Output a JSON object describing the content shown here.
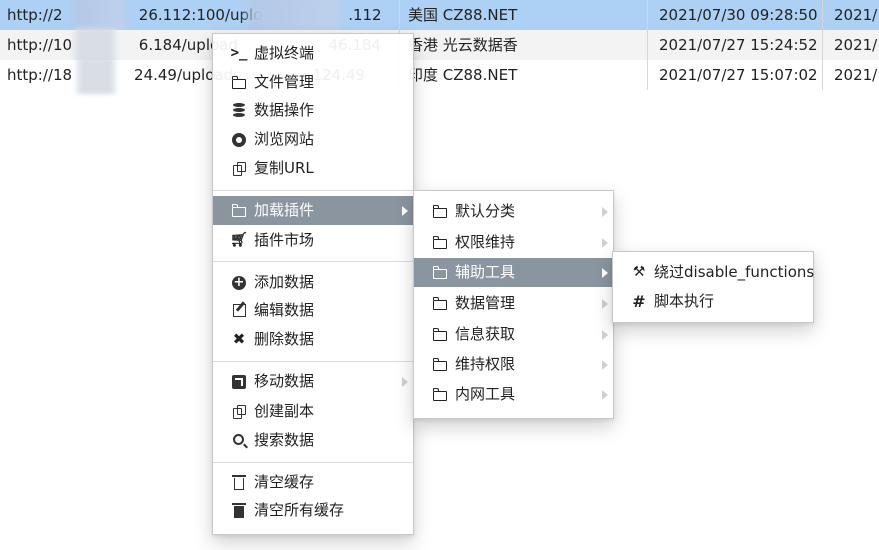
{
  "table": {
    "rows": [
      {
        "url": "http://2                26.112:100/uplo                  .112",
        "location": "美国 CZ88.NET",
        "time1": "2021/07/30 09:28:50",
        "time2": "2021/"
      },
      {
        "url": "http://10              6.184/upload                   46.184",
        "location": "香港 光云数据香",
        "time1": "2021/07/27 15:24:52",
        "time2": "2021/"
      },
      {
        "url": "http://18             24.49/uploads               124.49",
        "location": "印度 CZ88.NET",
        "time1": "2021/07/27 15:07:02",
        "time2": "2021/"
      }
    ]
  },
  "context_menu": {
    "items": [
      {
        "label": "虚拟终端",
        "icon": "terminal-icon"
      },
      {
        "label": "文件管理",
        "icon": "folder-icon"
      },
      {
        "label": "数据操作",
        "icon": "database-icon"
      },
      {
        "label": "浏览网站",
        "icon": "chrome-icon"
      },
      {
        "label": "复制URL",
        "icon": "copy-icon"
      },
      {
        "label": "加载插件",
        "icon": "folder-icon"
      },
      {
        "label": "插件市场",
        "icon": "cart-icon"
      },
      {
        "label": "添加数据",
        "icon": "plus-circle-icon"
      },
      {
        "label": "编辑数据",
        "icon": "edit-icon"
      },
      {
        "label": "删除数据",
        "icon": "close-icon"
      },
      {
        "label": "移动数据",
        "icon": "share-icon"
      },
      {
        "label": "创建副本",
        "icon": "copy-icon"
      },
      {
        "label": "搜索数据",
        "icon": "search-icon"
      },
      {
        "label": "清空缓存",
        "icon": "trash-icon"
      },
      {
        "label": "清空所有缓存",
        "icon": "trash-solid-icon"
      }
    ]
  },
  "plugin_submenu": {
    "items": [
      {
        "label": "默认分类",
        "icon": "folder-open-icon"
      },
      {
        "label": "权限维持",
        "icon": "folder-open-icon"
      },
      {
        "label": "辅助工具",
        "icon": "folder-open-icon"
      },
      {
        "label": "数据管理",
        "icon": "folder-open-icon"
      },
      {
        "label": "信息获取",
        "icon": "folder-open-icon"
      },
      {
        "label": "维持权限",
        "icon": "folder-open-icon"
      },
      {
        "label": "内网工具",
        "icon": "folder-open-icon"
      }
    ]
  },
  "tools_submenu": {
    "items": [
      {
        "label": "绕过disable_functions",
        "icon": "gavel-icon"
      },
      {
        "label": "脚本执行",
        "icon": "hash-icon"
      }
    ]
  },
  "colors": {
    "selected_row": "#add1f5",
    "active_menu_item": "#8a95a0"
  }
}
